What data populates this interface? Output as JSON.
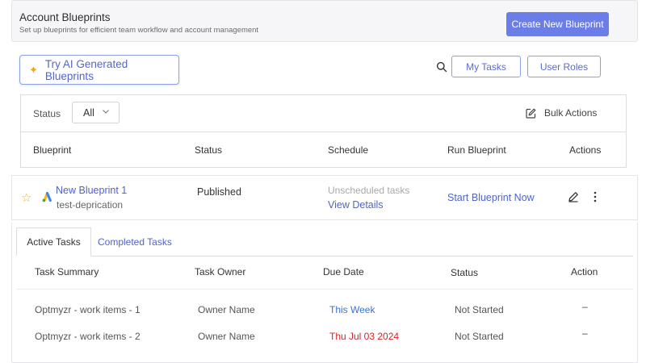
{
  "header": {
    "title": "Account Blueprints",
    "subtitle": "Set up blueprints for efficient team workflow and account management",
    "create_button": "Create New Blueprint"
  },
  "toolbar": {
    "ai_button": "Try AI Generated Blueprints",
    "ai_icon": "sparkle-icon",
    "search_icon": "search-icon",
    "my_tasks": "My Tasks",
    "user_roles": "User Roles"
  },
  "filter": {
    "status_label": "Status",
    "status_value": "All",
    "bulk_actions": "Bulk Actions"
  },
  "table": {
    "columns": [
      "Blueprint",
      "Status",
      "Schedule",
      "Run Blueprint",
      "Actions"
    ],
    "rows": [
      {
        "name": "New Blueprint 1",
        "account": "test-deprication",
        "status": "Published",
        "schedule_text": "Unscheduled tasks",
        "schedule_link": "View Details",
        "run_link": "Start Blueprint Now"
      }
    ]
  },
  "tasks": {
    "tabs": [
      "Active Tasks",
      "Completed Tasks"
    ],
    "active_tab": "Active Tasks",
    "columns": [
      "Task Summary",
      "Task Owner",
      "Due Date",
      "Status",
      "Action"
    ],
    "rows": [
      {
        "summary": "Optmyzr - work items - 1",
        "owner": "Owner Name",
        "due": "This Week",
        "status": "Not Started",
        "action": "–"
      },
      {
        "summary": "Optmyzr - work items - 2",
        "owner": "Owner Name",
        "due": "Thu Jul 03 2024",
        "status": "Not Started",
        "action": "–"
      }
    ]
  },
  "colors": {
    "accent": "#6b7ee8",
    "link": "#4f63cc",
    "overdue": "#d42424",
    "due_soon": "#3d6fd4",
    "star": "#f0b429"
  }
}
